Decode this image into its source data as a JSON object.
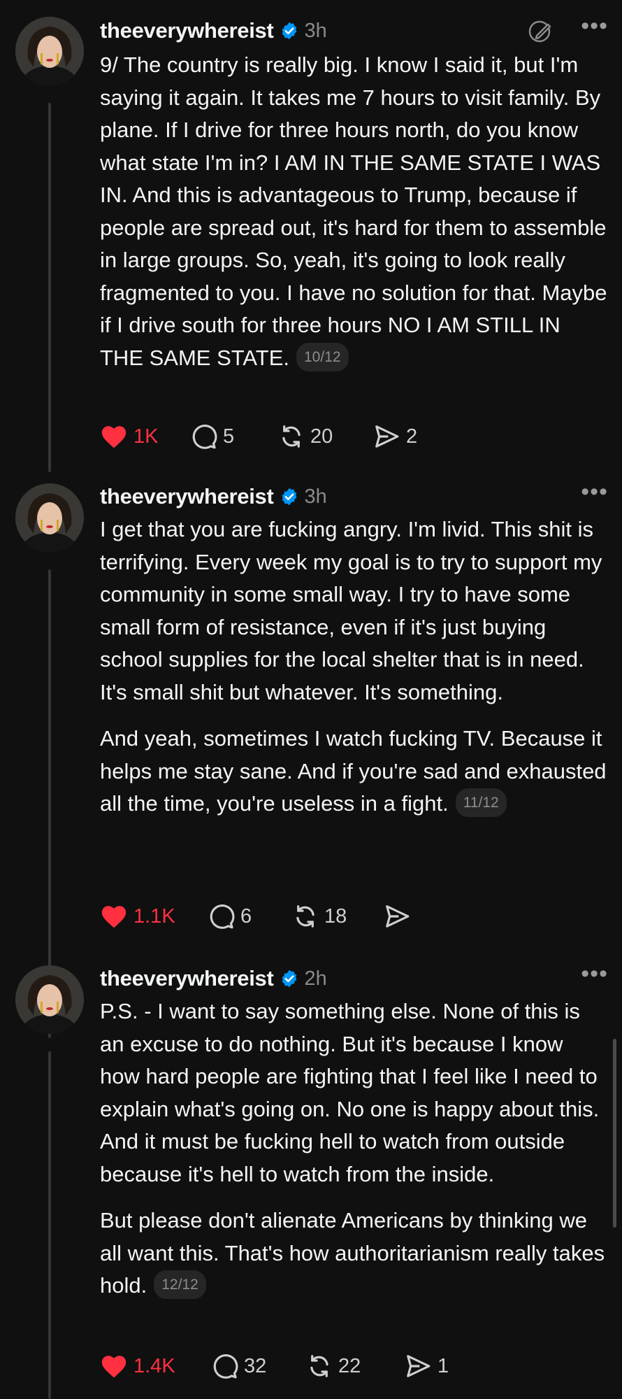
{
  "posts": [
    {
      "username": "theeverywhereist",
      "time": "3h",
      "paragraphs": [
        "9/ The country is really big. I know I said it, but I'm saying it again. It takes me 7 hours to visit family. By plane. If I drive for three hours north, do you know what state I'm in? I AM IN THE SAME STATE I WAS IN. And this is advantageous to Trump, because if people are spread out, it's hard for them to assemble in large groups. So, yeah, it's going to look really fragmented to you. I have no solution for that. Maybe if I drive south for three hours NO I AM STILL IN THE SAME STATE."
      ],
      "counter": "10/12",
      "likes": "1K",
      "replies": "5",
      "reposts": "20",
      "shares": "2"
    },
    {
      "username": "theeverywhereist",
      "time": "3h",
      "paragraphs": [
        "I get that you are fucking angry. I'm livid. This shit is terrifying. Every week my goal is to try to support my community in some small way. I try to have some small form of resistance, even if it's just buying school supplies for the local shelter that is in need. It's small shit but whatever. It's something.",
        "And yeah, sometimes I watch fucking TV. Because it helps me stay sane. And if you're sad and exhausted all the time, you're useless in a fight."
      ],
      "counter": "11/12",
      "likes": "1.1K",
      "replies": "6",
      "reposts": "18",
      "shares": ""
    },
    {
      "username": "theeverywhereist",
      "time": "2h",
      "paragraphs": [
        "P.S. - I want to say something else. None of this is an excuse to do nothing. But it's because I know how hard people are fighting that I feel like I need to explain what's going on. No one is happy about this. And it must be fucking hell to watch from outside because it's hell to watch from the inside.",
        "But please don't alienate Americans by thinking we all want this. That's how authoritarianism really takes hold."
      ],
      "counter": "12/12",
      "likes": "1.4K",
      "replies": "32",
      "reposts": "22",
      "shares": "1"
    }
  ],
  "icons": {
    "verified": "verified-badge-icon",
    "edit": "edit-pencil-icon",
    "more": "more-dots-icon",
    "like": "heart-icon",
    "reply": "comment-bubble-icon",
    "repost": "repost-icon",
    "share": "send-icon"
  },
  "colors": {
    "background": "#101010",
    "like": "#ff3040",
    "verified": "#0095f6",
    "muted": "#8a8a8a"
  }
}
